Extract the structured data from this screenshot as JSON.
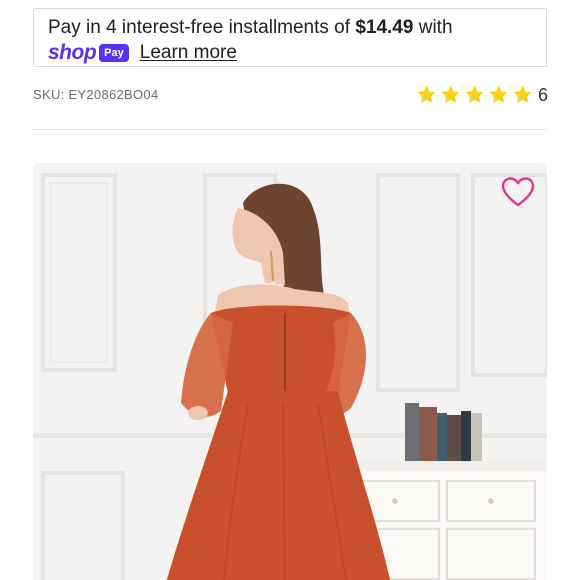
{
  "installments": {
    "text_before": "Pay in 4 interest-free installments of ",
    "amount": "$14.49",
    "text_after": " with",
    "brand_word": "shop",
    "brand_badge": "Pay",
    "learn_more": "Learn more"
  },
  "product": {
    "sku": "SKU: EY20862BO04",
    "rating": {
      "stars": 5,
      "count": "6"
    }
  },
  "colors": {
    "shop_purple": "#5a31f4",
    "star_yellow": "#f7d21a",
    "heart_pink": "#e0338f",
    "dress_rust": "#c8502c"
  },
  "image": {
    "alt": "product-photo-dress-back-view",
    "favorite_icon": "heart-outline-icon"
  }
}
